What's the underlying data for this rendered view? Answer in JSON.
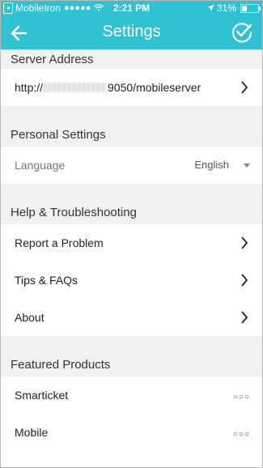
{
  "status": {
    "carrier": "MobileIron",
    "signal_dots": "●●●●●",
    "time": "2:21 PM",
    "battery": "31%",
    "battery_level": 0.31
  },
  "nav": {
    "title": "Settings"
  },
  "sections": {
    "server": {
      "header": "Server Address",
      "url_prefix": "http://",
      "url_suffix": "9050/mobileserver"
    },
    "personal": {
      "header": "Personal Settings",
      "language_label": "Language",
      "language_value": "English"
    },
    "help": {
      "header": "Help & Troubleshooting",
      "items": [
        "Report a Problem",
        "Tips & FAQs",
        "About"
      ]
    },
    "featured": {
      "header": "Featured Products",
      "items": [
        "Smarticket",
        "Mobile"
      ],
      "more_glyph": "○○○"
    }
  },
  "colors": {
    "accent": "#2ec2d3",
    "section_bg": "#f1f1f1"
  }
}
